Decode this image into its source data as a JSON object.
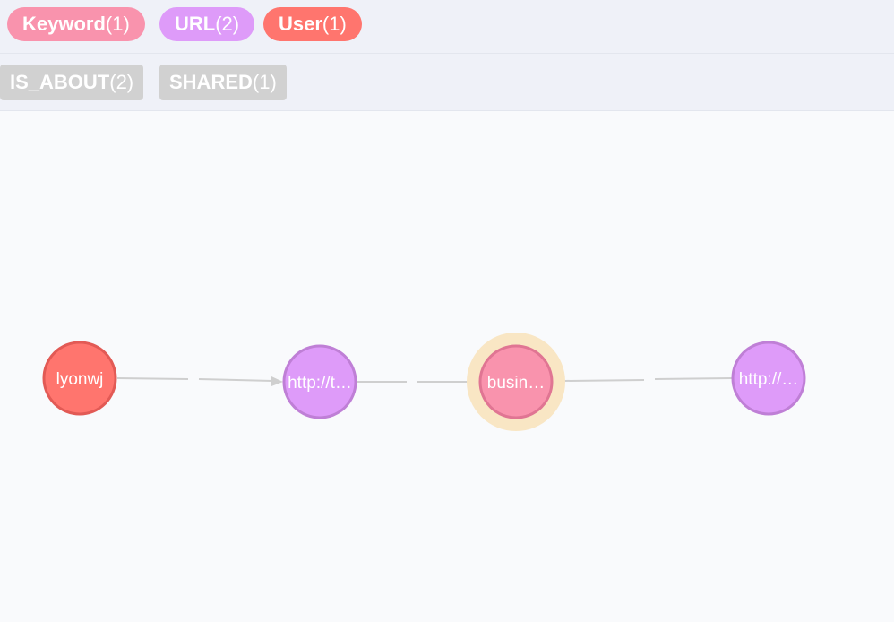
{
  "labels": [
    {
      "name": "Keyword",
      "count": "(1)",
      "color": "#f993ad"
    },
    {
      "name": "URL",
      "count": "(2)",
      "color": "#de9bf9"
    },
    {
      "name": "User",
      "count": "(1)",
      "color": "#ff756e"
    }
  ],
  "relationships": [
    {
      "name": "IS_ABOUT",
      "count": "(2)"
    },
    {
      "name": "SHARED",
      "count": "(1)"
    }
  ],
  "graph": {
    "nodes": [
      {
        "id": "user",
        "caption": "lyonwj",
        "fill": "#ff756e",
        "stroke": "#e25a55",
        "selected": false
      },
      {
        "id": "url1",
        "caption": "http://t…",
        "fill": "#de9bf9",
        "stroke": "#bf7fd6",
        "selected": false
      },
      {
        "id": "keyword",
        "caption": "busin…",
        "fill": "#f993ad",
        "stroke": "#e07593",
        "selected": true
      },
      {
        "id": "url2",
        "caption": "http://…",
        "fill": "#de9bf9",
        "stroke": "#bf7fd6",
        "selected": false
      }
    ],
    "selection_halo_color": "#f9e6c4",
    "edge_color": "#cfcfcf"
  }
}
